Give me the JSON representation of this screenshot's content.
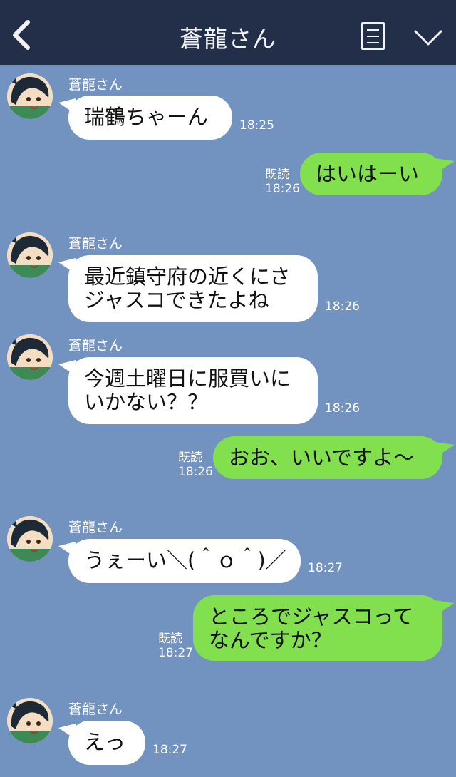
{
  "header": {
    "title": "蒼龍さん",
    "back_icon": "chevron-left-icon",
    "menu_icon": "list-icon",
    "collapse_icon": "chevron-down-icon",
    "background": "#232f48"
  },
  "colors": {
    "chat_background": "#7292c0",
    "incoming_bubble": "#ffffff",
    "outgoing_bubble": "#82e04e"
  },
  "messages": [
    {
      "direction": "in",
      "sender": "蒼龍さん",
      "lines": [
        "瑞鶴ちゃーん"
      ],
      "time": "18:25"
    },
    {
      "direction": "out",
      "read": "既読",
      "lines": [
        "はいはーい"
      ],
      "time": "18:26"
    },
    {
      "direction": "in",
      "sender": "蒼龍さん",
      "lines": [
        "最近鎮守府の近くにさ",
        "ジャスコできたよね"
      ],
      "time": "18:26"
    },
    {
      "direction": "in",
      "sender": "蒼龍さん",
      "lines": [
        "今週土曜日に服買いに",
        "いかない？？"
      ],
      "time": "18:26"
    },
    {
      "direction": "out",
      "read": "既読",
      "lines": [
        "おお、いいですよ〜"
      ],
      "time": "18:26"
    },
    {
      "direction": "in",
      "sender": "蒼龍さん",
      "lines": [
        "うぇーい＼(＾ｏ＾)／"
      ],
      "time": "18:27"
    },
    {
      "direction": "out",
      "read": "既読",
      "lines": [
        "ところでジャスコって",
        "なんですか？"
      ],
      "time": "18:27"
    },
    {
      "direction": "in",
      "sender": "蒼龍さん",
      "lines": [
        "えっ"
      ],
      "time": "18:27"
    }
  ]
}
